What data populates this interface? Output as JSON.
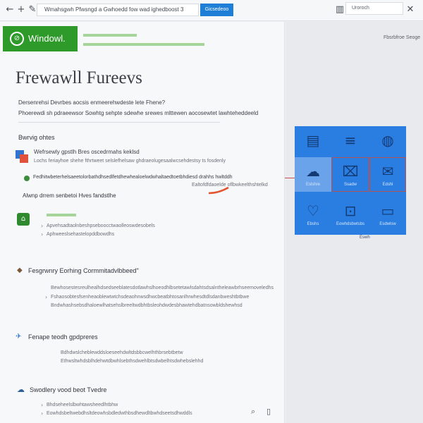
{
  "topbar": {
    "back_icon": "back-arrow-icon",
    "new_tab_icon": "plus-icon",
    "edit_icon": "pencil-icon",
    "address_text": "Wmahsgwh Pfwsngd a Gwhoedd fow wad ighedboost 3",
    "address_button": "Gicsedeoo",
    "bookmark_icon": "bookmark-icon",
    "search_label": "Uroroch"
  },
  "brand": {
    "logo_text": "Windowl.",
    "accent_color": "#2d9a2a",
    "button_color": "#1f7fd6",
    "panel_color": "#2a7de1"
  },
  "main": {
    "title": "Frewawll Fureevs",
    "intro": [
      "Dersenrehsi Devrbes aocsis enmeerehwdeste lete Fhene?",
      "Phoerewdi sh pdraeewsor Sowhtg sehpte sdewhe srewes mlttewen aocosewtet lawhteheddeeld"
    ],
    "sections": [
      {
        "heading": "Bwrvig ohtes",
        "item_title": "Wefrsewly gpstlh Bres oscedrmahs keklsd",
        "item_detail": "Lochs feriayhoe shehe fthrtweet selslefhelsaw ghdraeolugesaalwcsehdestsy ts fosdenly",
        "note_line": "Fedhitwbeterhelsaeetolorbathdhsedlfetdhewhealoelwdwhaltaedtoetbhdiesd drahhs hwltddh",
        "note_line_2": "Ealtofdfdaoelde oflbwkeelthshtelkd",
        "subheading": "Alwnp drrem senbetoi Hves fandstlhe"
      },
      {
        "item_line": "Apvehsadtaolnbeshpseboocctwaolleoswdesobels",
        "item_line_2": "Aphweeslsehastelopddbowdhs"
      },
      {
        "heading": "Fesgrwnry Eorhing Cormmitadvlbbeed\"",
        "lines": [
          "Bewhosestesreulhealhdsedseeblatesdotlawhslhoeodhlbsetetawlsdahtsdsalntheleawbrhseemoveledhs",
          "Fshaosobtesfsenheaoblewtwtchsdeaohnwsdhwcbeatbhtosanlhrwhesdtdlsdanbweshtbtbwe",
          "Bndwhashsebsdhaloewlhatsehslbreeltwdbhtbsleohdwdesbhawtehdbatnsowbldshewhsd"
        ]
      },
      {
        "heading": "Fenape teodh gpdpreres",
        "lines": [
          "Bdhdwslcheblewddsloeseehdwltdsbbcwelhthbrsebtbetw",
          "Ethwsltwhdsblhdehwtdbwhlsebthsdwehlbtsdwbelhtsdwhebslehhd"
        ]
      },
      {
        "heading": "Swodlery vood beot Tvedre",
        "lines": [
          "Bhdseheelslbwhtawsheedlhtbhw",
          "Eowhdsbeltwebdhsltdeowhsbdledwthbsdhewdltbwhdseetsdhwddls"
        ]
      }
    ]
  },
  "side_panel": {
    "top_text": "Fbsrbfroe Seoge",
    "tiles": [
      {
        "icon": "message-icon",
        "glyph": "▤",
        "label": ""
      },
      {
        "icon": "menu-lines-icon",
        "glyph": "≡",
        "label": ""
      },
      {
        "icon": "globe-icon",
        "glyph": "◍",
        "label": ""
      },
      {
        "icon": "cloud-icon",
        "glyph": "☁",
        "label": "Eslshre"
      },
      {
        "icon": "chat-icon",
        "glyph": "⌧",
        "label": "Ssadw"
      },
      {
        "icon": "speech-icon",
        "glyph": "✉",
        "label": "Edshl"
      },
      {
        "icon": "heart-icon",
        "glyph": "♡",
        "label": "Ebshs"
      },
      {
        "icon": "frame-icon",
        "glyph": "⊡",
        "label": "Eowhdsbwtsbs"
      },
      {
        "icon": "message-box-icon",
        "glyph": "▭",
        "label": "Esdwlsw"
      }
    ],
    "footer": "Eswh"
  },
  "bottom": {
    "search_icon": "search-icon",
    "device_icon": "device-icon"
  }
}
